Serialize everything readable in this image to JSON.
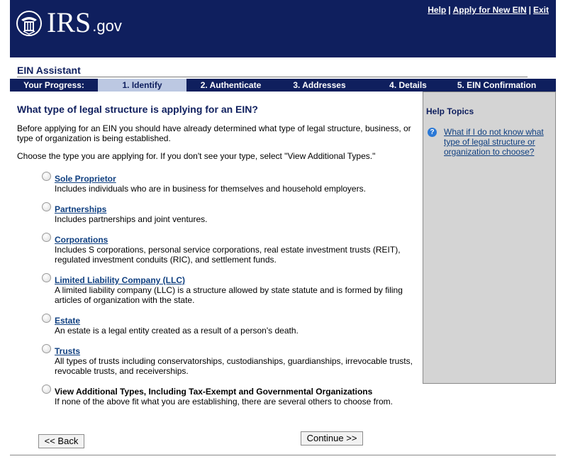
{
  "header": {
    "logo_text": "IRS",
    "logo_suffix": ".gov",
    "links": [
      "Help",
      "Apply for New EIN",
      "Exit"
    ],
    "separator": "|"
  },
  "title": "EIN Assistant",
  "progress": {
    "label": "Your Progress:",
    "steps": [
      "1. Identify",
      "2. Authenticate",
      "3. Addresses",
      "4. Details",
      "5. EIN Confirmation"
    ],
    "active_index": 0
  },
  "main": {
    "heading": "What type of legal structure is applying for an EIN?",
    "intro1": "Before applying for an EIN you should have already determined what type of legal structure, business, or type of organization is being established.",
    "intro2": "Choose the type you are applying for. If you don't see your type, select \"View Additional Types.\"",
    "options": [
      {
        "title": "Sole Proprietor",
        "desc": "Includes individuals who are in business for themselves and household employers."
      },
      {
        "title": "Partnerships",
        "desc": "Includes partnerships and joint ventures."
      },
      {
        "title": "Corporations",
        "desc": "Includes S corporations, personal service corporations, real estate investment trusts (REIT), regulated investment conduits (RIC), and settlement funds."
      },
      {
        "title": "Limited Liability Company (LLC)",
        "desc": "A limited liability company (LLC) is a structure allowed by state statute and is formed by filing articles of organization with the state."
      },
      {
        "title": "Estate",
        "desc": "An estate is a legal entity created as a result of a person's death."
      },
      {
        "title": "Trusts",
        "desc": "All types of trusts including conservatorships, custodianships, guardianships, irrevocable trusts, revocable trusts, and receiverships."
      },
      {
        "title": "View Additional Types, Including Tax-Exempt and Governmental Organizations",
        "desc": "If none of the above fit what you are establishing, there are several others to choose from."
      }
    ]
  },
  "help": {
    "heading": "Help Topics",
    "icon": "help-question-icon",
    "link": "What if I do not know what type of legal structure or organization to choose?"
  },
  "buttons": {
    "back": "<< Back",
    "continue": "Continue >>"
  },
  "colors": {
    "header_bg": "#0f1f5e",
    "active_step_bg": "#bcc8e2",
    "help_bg": "#d4d4d4",
    "link": "#0f3f80"
  }
}
